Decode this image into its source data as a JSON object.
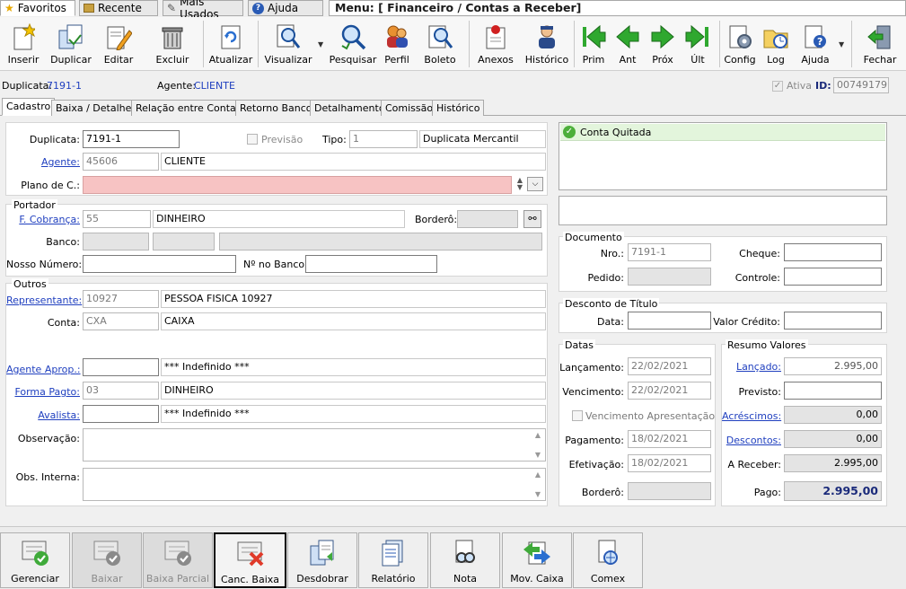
{
  "top_tabs": {
    "favoritos": "Favoritos",
    "recente": "Recente",
    "mais_usados": "Mais Usados",
    "ajuda": "Ajuda"
  },
  "menu_title": "Menu: [ Financeiro / Contas a Receber]",
  "toolbar": {
    "inserir": "Inserir",
    "duplicar": "Duplicar",
    "editar": "Editar",
    "excluir": "Excluir",
    "atualizar": "Atualizar",
    "visualizar": "Visualizar",
    "pesquisar": "Pesquisar",
    "perfil": "Perfil",
    "boleto": "Boleto",
    "anexos": "Anexos",
    "historico": "Histórico",
    "prim": "Prim",
    "ant": "Ant",
    "prox": "Próx",
    "ult": "Últ",
    "config": "Config",
    "log": "Log",
    "ajuda": "Ajuda",
    "fechar": "Fechar"
  },
  "info": {
    "duplicata_label": "Duplicata:",
    "duplicata_value": "7191-1",
    "agente_label": "Agente:",
    "agente_value": "CLIENTE",
    "ativa_label": "Ativa",
    "ativa_checked": true,
    "id_label": "ID:",
    "id_value": "00749179"
  },
  "subtabs": [
    "Cadastro",
    "Baixa / Detalhes",
    "Relação entre Contas",
    "Retorno Banco",
    "Detalhamento",
    "Comissão",
    "Histórico"
  ],
  "form": {
    "duplicata_label": "Duplicata:",
    "duplicata_value": "7191-1",
    "previsao_label": "Previsão",
    "tipo_label": "Tipo:",
    "tipo_code": "1",
    "tipo_desc": "Duplicata Mercantil",
    "agente_label": "Agente:",
    "agente_code": "45606",
    "agente_name": "CLIENTE",
    "plano_label": "Plano de C.:",
    "portador_legend": "Portador",
    "cobranca_label": "F. Cobrança:",
    "cobranca_code": "55",
    "cobranca_desc": "DINHEIRO",
    "bordero_label": "Borderô:",
    "banco_label": "Banco:",
    "nosso_label": "Nosso Número:",
    "nobanco_label": "Nº no Banco:",
    "outros_legend": "Outros",
    "representante_label": "Representante:",
    "representante_code": "10927",
    "representante_name": "PESSOA FISICA 10927",
    "conta_label": "Conta:",
    "conta_code": "CXA",
    "conta_name": "CAIXA",
    "aprop_label": "Agente Aprop.:",
    "aprop_name": "*** Indefinido ***",
    "pagto_label": "Forma Pagto:",
    "pagto_code": "03",
    "pagto_name": "DINHEIRO",
    "avalista_label": "Avalista:",
    "avalista_name": "*** Indefinido ***",
    "obs_label": "Observação:",
    "obsint_label": "Obs. Interna:"
  },
  "right": {
    "status": "Conta Quitada",
    "documento_legend": "Documento",
    "nro_label": "Nro.:",
    "nro_value": "7191-1",
    "cheque_label": "Cheque:",
    "pedido_label": "Pedido:",
    "controle_label": "Controle:",
    "desconto_legend": "Desconto de Título",
    "data_label": "Data:",
    "valor_credito_label": "Valor Crédito:",
    "datas_legend": "Datas",
    "lancamento_label": "Lançamento:",
    "lancamento_value": "22/02/2021",
    "vencimento_label": "Vencimento:",
    "vencimento_value": "22/02/2021",
    "venc_apres_label": "Vencimento Apresentação",
    "pagamento_label": "Pagamento:",
    "pagamento_value": "18/02/2021",
    "efetivacao_label": "Efetivação:",
    "efetivacao_value": "18/02/2021",
    "bordero_label": "Borderô:",
    "resumo_legend": "Resumo Valores",
    "lancado_label": "Lançado:",
    "lancado_value": "2.995,00",
    "previsto_label": "Previsto:",
    "acrescimos_label": "Acréscimos:",
    "acrescimos_value": "0,00",
    "descontos_label": "Descontos:",
    "descontos_value": "0,00",
    "areceber_label": "A Receber:",
    "areceber_value": "2.995,00",
    "pago_label": "Pago:",
    "pago_value": "2.995,00"
  },
  "bottom": {
    "gerenciar": "Gerenciar",
    "baixar": "Baixar",
    "baixa_parcial": "Baixa Parcial",
    "canc_baixa": "Canc. Baixa",
    "desdobrar": "Desdobrar",
    "relatorio": "Relatório",
    "nota": "Nota",
    "mov_caixa": "Mov. Caixa",
    "comex": "Comex"
  },
  "colors": {
    "link": "#1f3fbf",
    "green_nav": "#2fa82f",
    "quitada_bg": "#e3f5dc",
    "plano_bg": "#f7c3c3"
  }
}
